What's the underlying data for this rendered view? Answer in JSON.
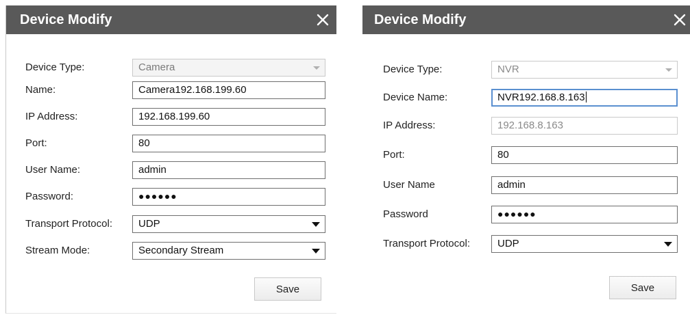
{
  "left_dialog": {
    "title": "Device Modify",
    "fields": {
      "device_type": {
        "label": "Device Type:",
        "value": "Camera"
      },
      "name": {
        "label": "Name:",
        "value": "Camera192.168.199.60"
      },
      "ip_address": {
        "label": "IP Address:",
        "value": "192.168.199.60"
      },
      "port": {
        "label": "Port:",
        "value": "80"
      },
      "user_name": {
        "label": "User Name:",
        "value": "admin"
      },
      "password": {
        "label": "Password:",
        "value": "●●●●●●"
      },
      "transport_protocol": {
        "label": "Transport Protocol:",
        "value": "UDP"
      },
      "stream_mode": {
        "label": "Stream Mode:",
        "value": "Secondary Stream"
      }
    },
    "save_label": "Save"
  },
  "right_dialog": {
    "title": "Device Modify",
    "fields": {
      "device_type": {
        "label": "Device Type:",
        "value": "NVR"
      },
      "device_name": {
        "label": "Device Name:",
        "value": "NVR192.168.8.163"
      },
      "ip_address": {
        "label": "IP Address:",
        "value": "192.168.8.163"
      },
      "port": {
        "label": "Port:",
        "value": "80"
      },
      "user_name": {
        "label": "User Name",
        "value": "admin"
      },
      "password": {
        "label": "Password",
        "value": "●●●●●●"
      },
      "transport_protocol": {
        "label": "Transport Protocol:",
        "value": "UDP"
      }
    },
    "save_label": "Save"
  },
  "icons": {
    "close": "close-icon",
    "dropdown": "chevron-down-icon"
  },
  "colors": {
    "titlebar": "#595959",
    "focus_border": "#5a8fd0"
  }
}
